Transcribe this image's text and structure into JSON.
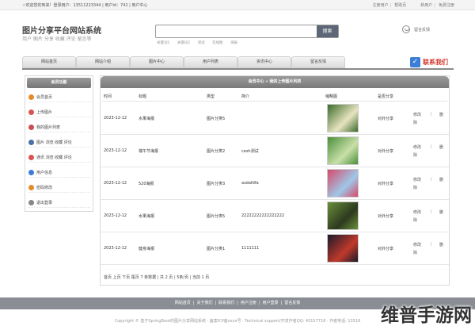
{
  "topbar": {
    "welcome": "☆欢迎您的到来！登录用户：13511223344 | 用户Id：742 | 用户中心",
    "links": [
      "注册用户",
      "帮助页",
      "新用户",
      "免费注册"
    ]
  },
  "header": {
    "title": "图片分享平台网站系统",
    "subtitle": "用户 图片 分享 收藏 评论 留言等",
    "search_placeholder": "",
    "search_button": "搜索",
    "hot_words": [
      "关键词1",
      "关键词2",
      "测试",
      "在线图",
      "海报"
    ],
    "feedback_label": "留言反馈"
  },
  "nav": {
    "items": [
      "网站首页",
      "网站介绍",
      "图片中心",
      "用户列表",
      "资讯中心",
      "留言反馈"
    ],
    "contact": "联系我们"
  },
  "sidebar": {
    "title": "会员功能",
    "items": [
      {
        "label": "会员首页",
        "icon": "home-icon",
        "color": "#e58a2b"
      },
      {
        "label": "上传图片",
        "icon": "upload-icon",
        "color": "#d9534f"
      },
      {
        "label": "我的图片列表",
        "icon": "image-list-icon",
        "color": "#c94f4f"
      },
      {
        "label": "图片 浏览 收藏 评论",
        "icon": "browse-icon",
        "color": "#4a6fa5"
      },
      {
        "label": "通讯 浏览 收藏 评论",
        "icon": "message-icon",
        "color": "#d9534f"
      },
      {
        "label": "用户信息",
        "icon": "user-info-icon",
        "color": "#3b7dd8"
      },
      {
        "label": "密码修改",
        "icon": "password-icon",
        "color": "#e58a2b"
      },
      {
        "label": "退出登录",
        "icon": "logout-icon",
        "color": "#888888"
      }
    ]
  },
  "panel": {
    "title": "会员中心 » 我的上传图片列表",
    "columns": [
      "时间",
      "标题",
      "类型",
      "简介",
      "缩略图",
      "是否分享",
      ""
    ],
    "rows": [
      {
        "time": "2023-12-12",
        "title": "水果海报",
        "type": "图片分类5",
        "intro": "",
        "share": "对外分享",
        "thumb_colors": [
          "#3b6b2a",
          "#e8e4c0"
        ]
      },
      {
        "time": "2023-12-12",
        "title": "端午节海报",
        "type": "图片分类2",
        "intro": "cesh测试",
        "share": "对外分享",
        "thumb_colors": [
          "#4a8f3a",
          "#c9e0a8"
        ]
      },
      {
        "time": "2023-12-12",
        "title": "520海报",
        "type": "图片分类3",
        "intro": "asdafdfa",
        "share": "对外分享",
        "thumb_colors": [
          "#d64a6a",
          "#9fc7e8"
        ]
      },
      {
        "time": "2023-12-12",
        "title": "水果海报",
        "type": "图片分类5",
        "intro": "22222222222222222",
        "share": "对外分享",
        "thumb_colors": [
          "#6a8f3a",
          "#2d3a1f"
        ]
      },
      {
        "time": "2023-12-12",
        "title": "健身海报",
        "type": "图片分类1",
        "intro": "1111111",
        "share": "对外分享",
        "thumb_colors": [
          "#1a1a2a",
          "#c0392b"
        ]
      }
    ],
    "op_edit": "修改",
    "op_sep": "|",
    "op_delete_1": "删",
    "op_delete_2": "除",
    "pager": "首页 上页 下页 尾页 7 条数据 | 共 2 页 | 5条/页 | 当前 1 页"
  },
  "footer": {
    "links": [
      "网站首页",
      "关于我们",
      "联系我们",
      "用户注册",
      "用户登录",
      "留言反馈"
    ],
    "copyright": "Copyright © 基于SpringBoot的图片分享网站系统 · 备案ICP备xxxx号 · Technical support/开发作者QQ: 45157718 · 作者电话: 13516",
    "watermark": "维普手游网"
  }
}
